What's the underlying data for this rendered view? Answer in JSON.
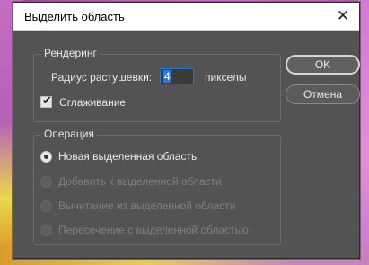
{
  "dialog": {
    "title": "Выделить область",
    "close_label": "✕"
  },
  "rendering": {
    "legend": "Рендеринг",
    "radius_label": "Радиус растушевки:",
    "radius_value": "4",
    "units": "пикселы",
    "smoothing_label": "Сглаживание",
    "smoothing_checked": true
  },
  "operation": {
    "legend": "Операция",
    "options": [
      {
        "label": "Новая выделенная область",
        "selected": true,
        "enabled": true
      },
      {
        "label": "Добавить к выделенной области",
        "selected": false,
        "enabled": false
      },
      {
        "label": "Вычитание из выделенной области",
        "selected": false,
        "enabled": false
      },
      {
        "label": "Пересечение с выделенной областью",
        "selected": false,
        "enabled": false
      }
    ]
  },
  "buttons": {
    "ok": "OK",
    "cancel": "Отмена"
  }
}
